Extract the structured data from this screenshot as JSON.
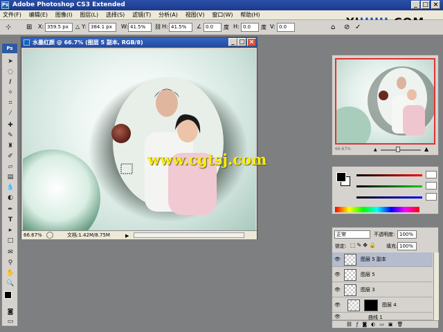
{
  "window": {
    "app_icon": "Ps",
    "title": "Adobe Photoshop CS3 Extended"
  },
  "menu": [
    "文件(F)",
    "编辑(E)",
    "图像(I)",
    "图层(L)",
    "选择(S)",
    "滤镜(T)",
    "分析(A)",
    "视图(V)",
    "窗口(W)",
    "帮助(H)"
  ],
  "options": {
    "x_label": "X:",
    "x_value": "359.5 px",
    "y_label": "Y:",
    "y_value": "384.1 px",
    "w_label": "W:",
    "w_value": "41.5%",
    "h_label": "H:",
    "h_value": "41.5%",
    "angle_value": "0.0",
    "angle_unit": "度",
    "hskew_label": "H:",
    "hskew_value": "0.0",
    "hskew_unit": "度",
    "vskew_label": "V:",
    "vskew_value": "0.0"
  },
  "logo": {
    "part1": "YI",
    "part2": "HUU",
    "part3": ".COM"
  },
  "tools_header": "Ps",
  "document": {
    "title": "水墨红颜 @ 66.7% (图层 5 副本, RGB/8)",
    "zoom": "66.67%",
    "doc_info": "文档:1.42M/8.75M"
  },
  "navigator": {
    "zoom": "66.67%"
  },
  "watermark": "www.cgtsj.com",
  "layers_panel": {
    "blend_mode": "正常",
    "opacity_label": "不透明度:",
    "opacity_value": "100%",
    "lock_label": "锁定:",
    "fill_label": "填充:",
    "fill_value": "100%",
    "layers": [
      {
        "name": "图层 5 副本",
        "selected": true
      },
      {
        "name": "图层 5",
        "selected": false
      },
      {
        "name": "图层 3",
        "selected": false
      },
      {
        "name": "图层 4",
        "selected": false
      },
      {
        "name": "曲线 1",
        "selected": false
      }
    ]
  },
  "colors": {
    "accent": "#2c5aa0",
    "watermark": "#ffee00",
    "nav_frame": "#dd3333"
  }
}
